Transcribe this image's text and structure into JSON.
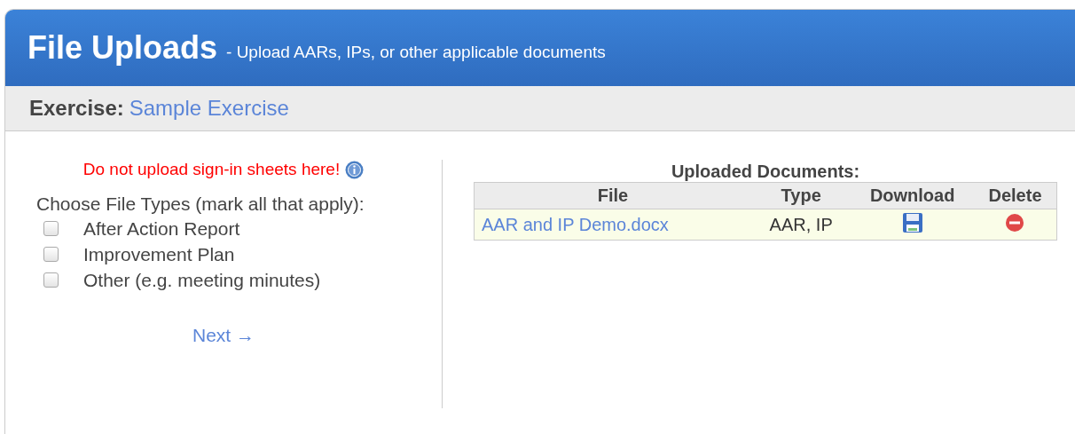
{
  "header": {
    "title": "File Uploads",
    "subtitle": "- Upload AARs, IPs, or other applicable documents"
  },
  "exercise": {
    "label": "Exercise:",
    "value": "Sample Exercise"
  },
  "warning": "Do not upload sign-in sheets here!",
  "file_types": {
    "label": "Choose File Types (mark all that apply):",
    "options": [
      {
        "label": "After Action Report",
        "checked": false
      },
      {
        "label": "Improvement Plan",
        "checked": false
      },
      {
        "label": "Other (e.g. meeting minutes)",
        "checked": false
      }
    ]
  },
  "next": "Next →",
  "uploaded": {
    "title": "Uploaded Documents:",
    "columns": [
      "File",
      "Type",
      "Download",
      "Delete"
    ],
    "rows": [
      {
        "file": "AAR and IP Demo.docx",
        "type": "AAR, IP"
      }
    ]
  }
}
